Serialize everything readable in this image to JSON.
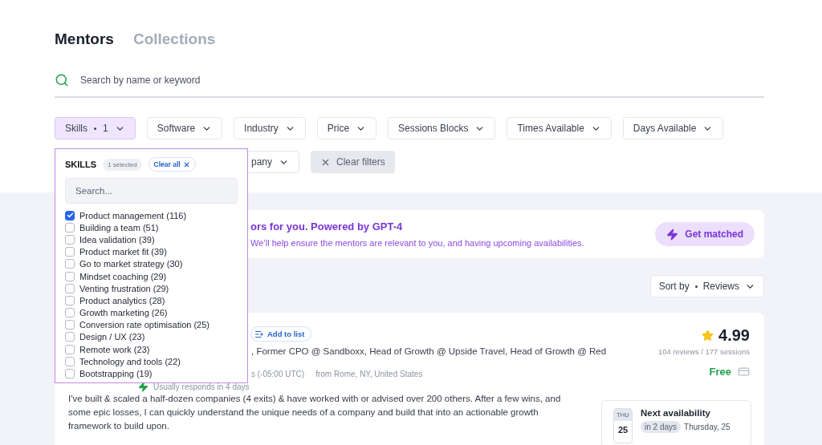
{
  "tabs": [
    {
      "label": "Mentors",
      "selected": true
    },
    {
      "label": "Collections",
      "selected": false
    }
  ],
  "search": {
    "placeholder": "Search by name or keyword"
  },
  "filters": [
    {
      "label": "Skills",
      "count": "1",
      "active": true
    },
    {
      "label": "Software",
      "active": false
    },
    {
      "label": "Industry",
      "active": false
    },
    {
      "label": "Price",
      "active": false
    },
    {
      "label": "Sessions Blocks",
      "active": false
    },
    {
      "label": "Times Available",
      "active": false
    },
    {
      "label": "Days Available",
      "active": false
    }
  ],
  "filters_row2": [
    {
      "label": "pany",
      "active": false
    }
  ],
  "clear_filters": "Clear filters",
  "skills_dropdown": {
    "title": "SKILLS",
    "selected_count": "1 selected",
    "clear_all": "Clear all",
    "search_placeholder": "Search...",
    "options": [
      {
        "label": "Product management (116)",
        "checked": true
      },
      {
        "label": "Building a team (51)",
        "checked": false
      },
      {
        "label": "Idea validation (39)",
        "checked": false
      },
      {
        "label": "Product market fit (39)",
        "checked": false
      },
      {
        "label": "Go to market strategy (30)",
        "checked": false
      },
      {
        "label": "Mindset coaching (29)",
        "checked": false
      },
      {
        "label": "Venting frustration (29)",
        "checked": false
      },
      {
        "label": "Product analytics (28)",
        "checked": false
      },
      {
        "label": "Growth marketing (26)",
        "checked": false
      },
      {
        "label": "Conversion rate optimisation (25)",
        "checked": false
      },
      {
        "label": "Design / UX (23)",
        "checked": false
      },
      {
        "label": "Remote work (23)",
        "checked": false
      },
      {
        "label": "Technology and tools (22)",
        "checked": false
      },
      {
        "label": "Bootstrapping (19)",
        "checked": false
      }
    ]
  },
  "banner": {
    "title": "ors for you. Powered by GPT-4",
    "text": "We’ll help ensure the mentors are relevant to you, and having upcoming availabilities.",
    "button": "Get matched"
  },
  "sort": {
    "label": "Sort by",
    "value": "Reviews"
  },
  "mentor": {
    "add_to_list": "Add to list",
    "headline": ", Former CPO @ Sandboxx, Head of Growth @ Upside Travel, Head of Growth @ Red",
    "timezone": "s (-05:00 UTC)",
    "location": "from Rome, NY, United States",
    "responds": "Usually responds in 4 days",
    "rating": "4.99",
    "reviews": "104 reviews / 177 sessions",
    "price": "Free",
    "bio": "I've built & scaled a half-dozen companies (4 exits) & have worked with or advised over 200 others. After a few wins, and some epic losses, I can quickly understand the unique needs of a company and build that into an actionable growth framework to build upon.",
    "availability": {
      "title": "Next availability",
      "day": "THU",
      "date": "25",
      "relative": "in 2 days",
      "when": "Thursday, 25"
    }
  }
}
